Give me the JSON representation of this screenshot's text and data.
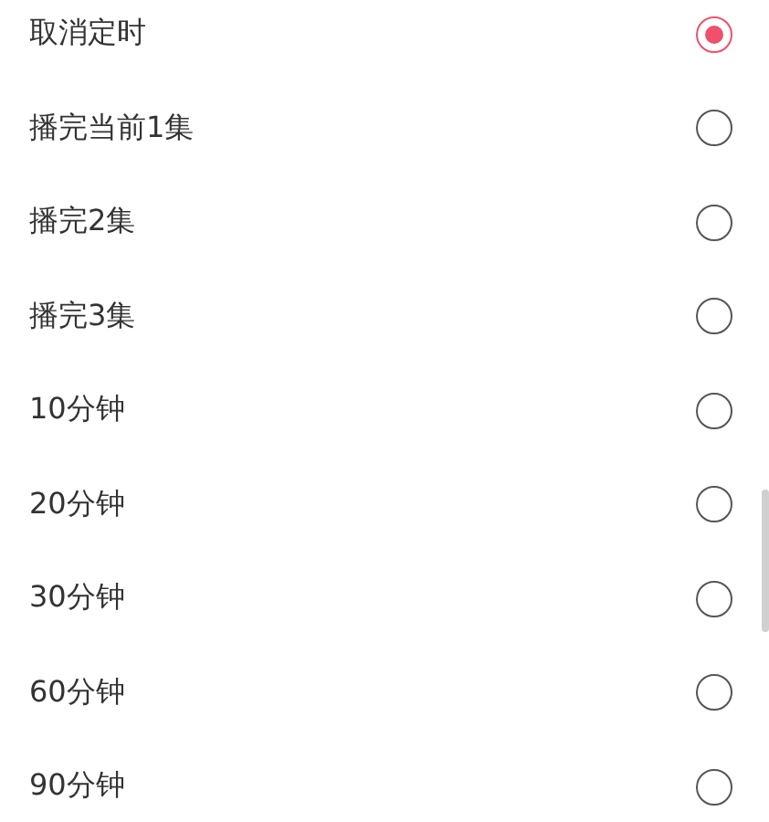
{
  "options": [
    {
      "label": "取消定时",
      "selected": true
    },
    {
      "label": "播完当前1集",
      "selected": false
    },
    {
      "label": "播完2集",
      "selected": false
    },
    {
      "label": "播完3集",
      "selected": false
    },
    {
      "label": "10分钟",
      "selected": false
    },
    {
      "label": "20分钟",
      "selected": false
    },
    {
      "label": "30分钟",
      "selected": false
    },
    {
      "label": "60分钟",
      "selected": false
    },
    {
      "label": "90分钟",
      "selected": false
    }
  ]
}
